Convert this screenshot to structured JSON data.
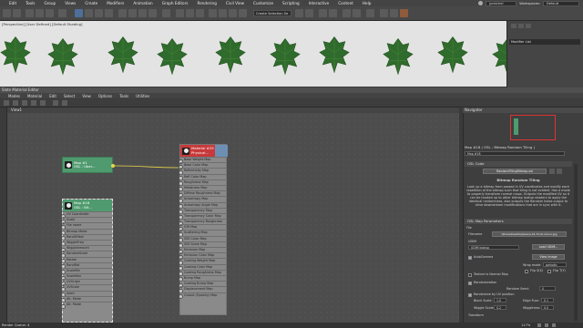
{
  "menubar": {
    "items": [
      "Edit",
      "Tools",
      "Group",
      "Views",
      "Create",
      "Modifiers",
      "Animation",
      "Graph Editors",
      "Rendering",
      "Civil View",
      "Customize",
      "Scripting",
      "Interactive",
      "Content",
      "Help"
    ],
    "user": "jpmichel",
    "workspaces_label": "Workspaces:",
    "workspaces_value": "Default"
  },
  "toolbar": {
    "selection_set": "Create Selection Se"
  },
  "viewport": {
    "label": "[Perspective] [User Defined] [Default Shading]"
  },
  "right_panel": {
    "modifier_list": "Modifier List"
  },
  "sme": {
    "title": "Slate Material Editor",
    "menu": [
      "Modes",
      "Material",
      "Edit",
      "Select",
      "View",
      "Options",
      "Tools",
      "Utilities"
    ],
    "view_tab": "View1"
  },
  "nodes": {
    "map1": {
      "title": "Map #1",
      "subtitle": "OSL : Uber..."
    },
    "material": {
      "title": "Material #25",
      "subtitle": "Physical..."
    },
    "map18": {
      "title": "Map #18",
      "subtitle": "OSL : Bit..."
    },
    "material_slots": [
      "Base Weight Map",
      "Base Color Map",
      "Reflectivity Map",
      "Refl Color Map",
      "Roughness Map",
      "Metalness Map",
      "Diffuse Roughness Map",
      "Anisotropy Map",
      "Anisotropy Angle Map",
      "Transparency Map",
      "Transparency Color Map",
      "Transparency Roughness",
      "IOR Map",
      "Scattering Map",
      "SSS Color Map",
      "SSS Scale Map",
      "Emission Map",
      "Emission Color Map",
      "Coating Weight Map",
      "Coating Color Map",
      "Coating Roughness Map",
      "Bump Map",
      "Coating Bump Map",
      "Displacement Map",
      "Cutout (Opacity) Map"
    ],
    "map18_slots": [
      "UV Coordinate",
      "Scale",
      "File name",
      "Bitmap Mode",
      "RandOffset",
      "WiggleFreq",
      "WiggleAmount",
      "RandomScale",
      "Rotate",
      "RandRot",
      "ScaleMin",
      "ScaleMax",
      "UVOrigin",
      "UVScale",
      "Seed",
      "Alt. Mode",
      "Alt. Mode"
    ]
  },
  "navigator": {
    "title": "Navigator"
  },
  "properties": {
    "header": "Map #18  ( OSL : Bitmap Random Tiling )",
    "map_name": "Map #18",
    "osl_code_rollout": "OSL Code",
    "osl_file": "RandomTilingBitmap.osl",
    "shader_name": "Bitmap Random Tiling",
    "description": "Look up a bitmap from passed in UV coordinates and modify each repetition of the bitmap such that tiling is not evident. Has a mode to properly transform normal maps. Outputs the modified UV so it can be hooked up to other bitmap lookup shaders to apply the identical randomness, also outputs the Random Index output to drive downstream modifications that are in sync with it.",
    "params_rollout": "OSL Map Parameters",
    "file_label": "File",
    "filename_label": "Filename",
    "filename_value": "\\Share\\Desktop\\leave-01-front-colour.jpg",
    "udim_label": "UDIM",
    "udim_value": "UDIM lookup",
    "load_udim_btn": "Load UDIM...",
    "autogamma_label": "AutoGamma",
    "view_image_btn": "View Image",
    "wrap_mode_label": "Wrap mode",
    "wrap_mode_value": "periodic",
    "flip_s": "Flip S(X)",
    "flip_t": "Flip T(Y)",
    "texture_normal_label": "Texture is Normal Map",
    "randomization_label": "Randomization",
    "random_seed_label": "Random Seed:",
    "random_seed_value": "0",
    "randomize_label": "Randomize by UV position",
    "block_scale_label": "Block Scale:",
    "block_scale_value": "1.0",
    "edge_fuzz_label": "Edge Fuzz:",
    "edge_fuzz_value": "0.1",
    "wiggle_scale_label": "Wiggle Scale:",
    "wiggle_scale_value": "0.2",
    "wiggliness_label": "Wiggliness:",
    "wiggliness_value": "0.0",
    "transform_label": "Transform"
  },
  "status": {
    "render_queue": "Render Queue: 4",
    "zoom": "117%"
  }
}
